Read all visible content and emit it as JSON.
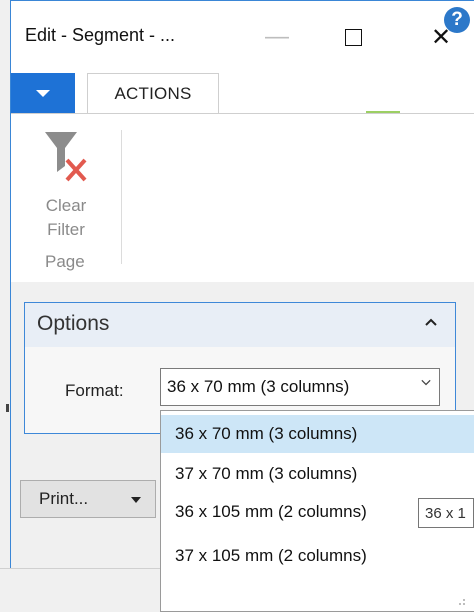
{
  "window": {
    "title": "Edit - Segment - ...",
    "controls": {
      "minimize": "—",
      "maximize": "maximize-icon",
      "close": "✕"
    }
  },
  "ribbon": {
    "menu_icon": "dropdown-arrow-icon",
    "tab_label": "ACTIONS",
    "help_icon": "?",
    "clear_filter_label_1": "Clear",
    "clear_filter_label_2": "Filter",
    "group_label": "Page"
  },
  "options": {
    "title": "Options",
    "format_label": "Format:",
    "format_value": "36 x 70 mm (3 columns)"
  },
  "print_button": {
    "label": "Print..."
  },
  "dropdown": {
    "items": [
      {
        "label": "36 x 70 mm (3 columns)",
        "selected": true
      },
      {
        "label": "37 x 70 mm (3 columns)",
        "selected": false
      },
      {
        "label": "36 x 105 mm (2 columns)",
        "selected": false
      },
      {
        "label": "37 x 105 mm (2 columns)",
        "selected": false
      }
    ],
    "tooltip": "36 x 1"
  },
  "colors": {
    "accent": "#1e72d6",
    "selection": "#cde6f7",
    "options_border": "#3e88d8"
  }
}
